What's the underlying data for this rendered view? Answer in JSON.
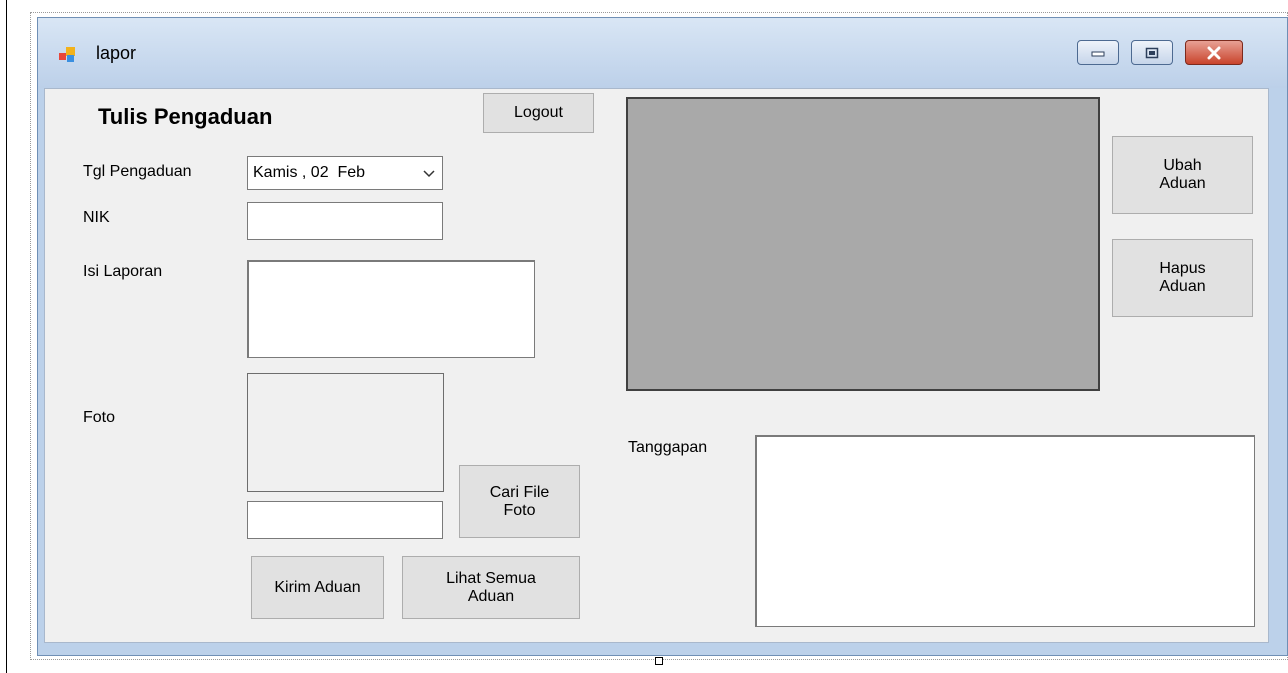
{
  "window": {
    "title": "lapor",
    "icon": "form-icon"
  },
  "controls": {
    "minimize": "minimize-icon",
    "maximize": "maximize-icon",
    "close": "close-icon",
    "close_color": "#c9442c"
  },
  "form": {
    "heading": "Tulis Pengaduan",
    "logout_label": "Logout",
    "tgl_label": "Tgl Pengaduan",
    "tgl_value": "Kamis , 02  Feb",
    "nik_label": "NIK",
    "nik_value": "",
    "isi_label": "Isi Laporan",
    "isi_value": "",
    "foto_label": "Foto",
    "foto_path_value": "",
    "cari_file_label": "Cari File\nFoto",
    "kirim_label": "Kirim Aduan",
    "lihat_label": "Lihat Semua\nAduan",
    "ubah_label": "Ubah\nAduan",
    "hapus_label": "Hapus\nAduan",
    "tanggapan_label": "Tanggapan",
    "tanggapan_value": ""
  },
  "colors": {
    "form_background": "#f0f0f0",
    "picture_fill": "#a9a9a9",
    "title_bar": "#bcd1ea"
  }
}
